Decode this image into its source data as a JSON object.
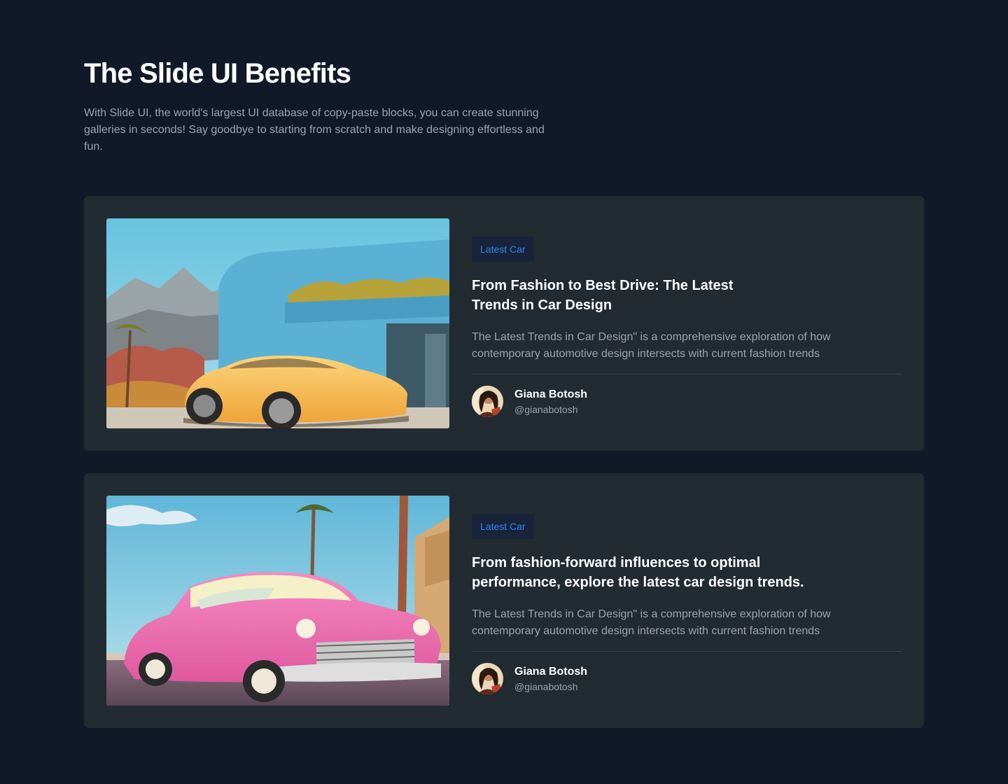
{
  "header": {
    "title": "The Slide UI Benefits",
    "intro": "With Slide UI, the world's largest UI database of copy-paste blocks, you can create stunning galleries in seconds! Say goodbye to starting from scratch and make designing effortless and fun."
  },
  "cards": [
    {
      "badge": "Latest Car",
      "title": "From Fashion to Best Drive: The Latest Trends in Car Design",
      "description": "The Latest Trends in Car Design\" is a comprehensive exploration of how contemporary automotive design intersects with current fashion trends",
      "author": {
        "name": "Giana Botosh",
        "handle": "@gianabotosh"
      }
    },
    {
      "badge": "Latest Car",
      "title": "From fashion-forward influences to optimal performance, explore the latest car design trends.",
      "description": "The Latest Trends in Car Design\" is a comprehensive exploration of how contemporary automotive design intersects with current fashion trends",
      "author": {
        "name": "Giana Botosh",
        "handle": "@gianabotosh"
      }
    }
  ],
  "colors": {
    "background": "#111827",
    "card": "#222a32",
    "badge_bg": "#17243a",
    "badge_text": "#3b82f6"
  }
}
